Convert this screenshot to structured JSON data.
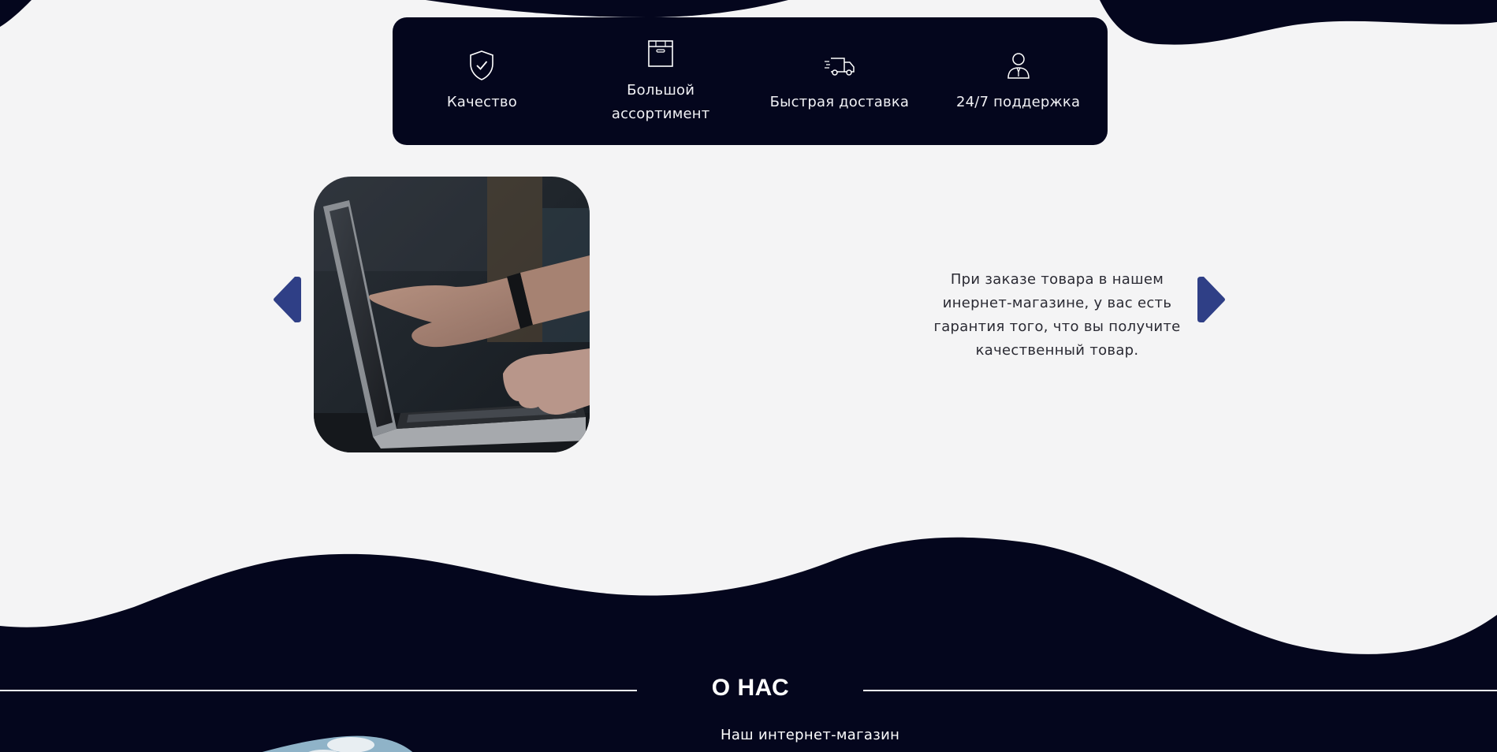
{
  "features": [
    {
      "label": "Качество",
      "icon": "shield-check-icon"
    },
    {
      "label": "Большой ассортимент",
      "icon": "box-icon"
    },
    {
      "label": "Быстрая доставка",
      "icon": "truck-icon"
    },
    {
      "label": "24/7 поддержка",
      "icon": "support-agent-icon"
    }
  ],
  "slider": {
    "image_alt": "hands-pointing-at-laptop-image",
    "text": "При заказе товара в нашем инернет-магазине, у вас есть гарантия того, что вы получите качественный товар.",
    "prev_icon": "chevron-left-icon",
    "next_icon": "chevron-right-icon"
  },
  "about": {
    "title": "О НАС",
    "text": "Наш интернет-магазин"
  },
  "colors": {
    "dark_navy": "#04061d",
    "background": "#f4f4f5",
    "arrow_blue": "#2f3f86"
  }
}
